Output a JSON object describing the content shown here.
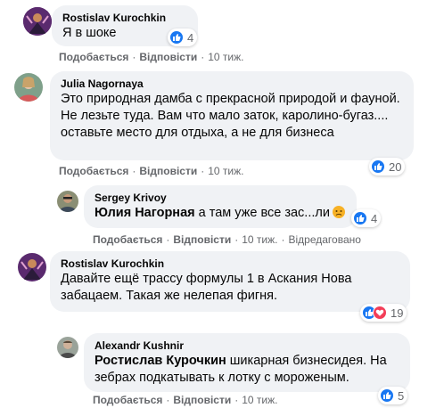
{
  "comments": [
    {
      "author": "Rostislav Kurochkin",
      "text": "Я в шоке",
      "likes": "4",
      "actions": {
        "like": "Подобається",
        "reply": "Відповісти",
        "time": "10 тиж."
      }
    },
    {
      "author": "Julia Nagornaya",
      "text": "Это природная дамба с прекрасной природой и фауной. Не лезьте туда. Вам что мало заток, каролино-бугаз.... оставьте место для отдыха, а не для бизнеса",
      "likes": "20",
      "actions": {
        "like": "Подобається",
        "reply": "Відповісти",
        "time": "10 тиж."
      }
    },
    {
      "author": "Sergey Krivoy",
      "mention": "Юлия Нагорная",
      "text": " а там уже все зас...ли",
      "emoji": "sad-face-emoji",
      "likes": "4",
      "actions": {
        "like": "Подобається",
        "reply": "Відповісти",
        "time": "10 тиж.",
        "edited": "Відредаговано"
      }
    },
    {
      "author": "Rostislav Kurochkin",
      "text": "Давайте ещё трассу формулы 1 в Аскания Нова забацаем. Такая же нелепая фигня.",
      "likes": "19",
      "actions": {
        "like": "Подобається",
        "reply": "Відповісти",
        "time": "10 тиж."
      }
    },
    {
      "author": "Alexandr Kushnir",
      "mention": "Ростислав Курочкин",
      "text": " шикарная бизнесидея. На зебрах подкатывать к лотку с мороженым.",
      "likes": "5",
      "actions": {
        "like": "Подобається",
        "reply": "Відповісти",
        "time": "10 тиж."
      }
    }
  ],
  "separator": "·",
  "colors": {
    "bubble": "#f0f2f5",
    "like_blue": "#1877f2",
    "love_red": "#f33e58",
    "meta_gray": "#65676b"
  }
}
